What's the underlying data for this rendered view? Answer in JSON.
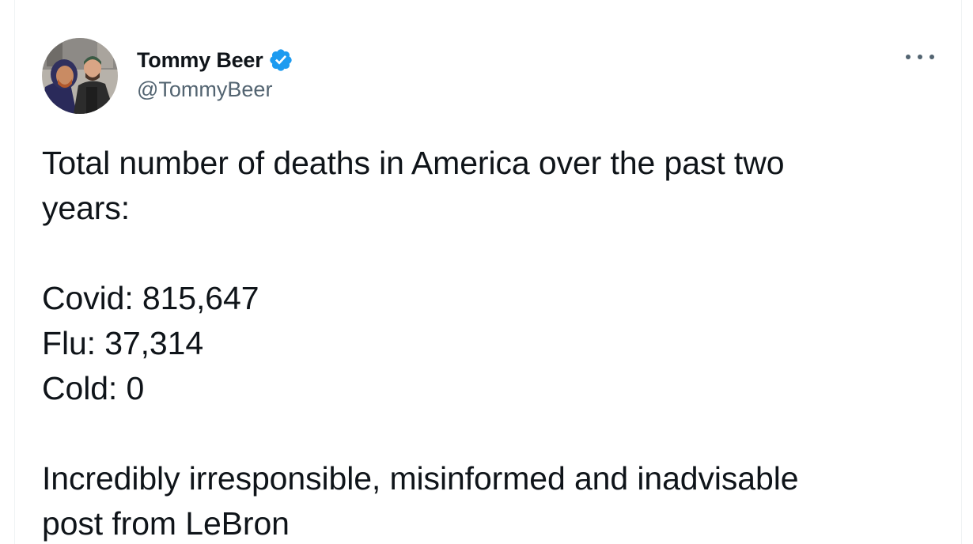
{
  "author": {
    "name": "Tommy Beer",
    "handle": "@TommyBeer",
    "verified": true
  },
  "icons": {
    "verified": "verified-badge-icon",
    "more": "more-options-icon"
  },
  "colors": {
    "verified_badge": "#1d9bf0",
    "text": "#0f1419",
    "secondary_text": "#536471"
  },
  "tweet": {
    "lines": [
      "Total number of deaths in America over the past two",
      "years:",
      "Covid: 815,647",
      "Flu: 37,314",
      "Cold: 0",
      "Incredibly irresponsible, misinformed and inadvisable",
      "post from LeBron"
    ]
  }
}
